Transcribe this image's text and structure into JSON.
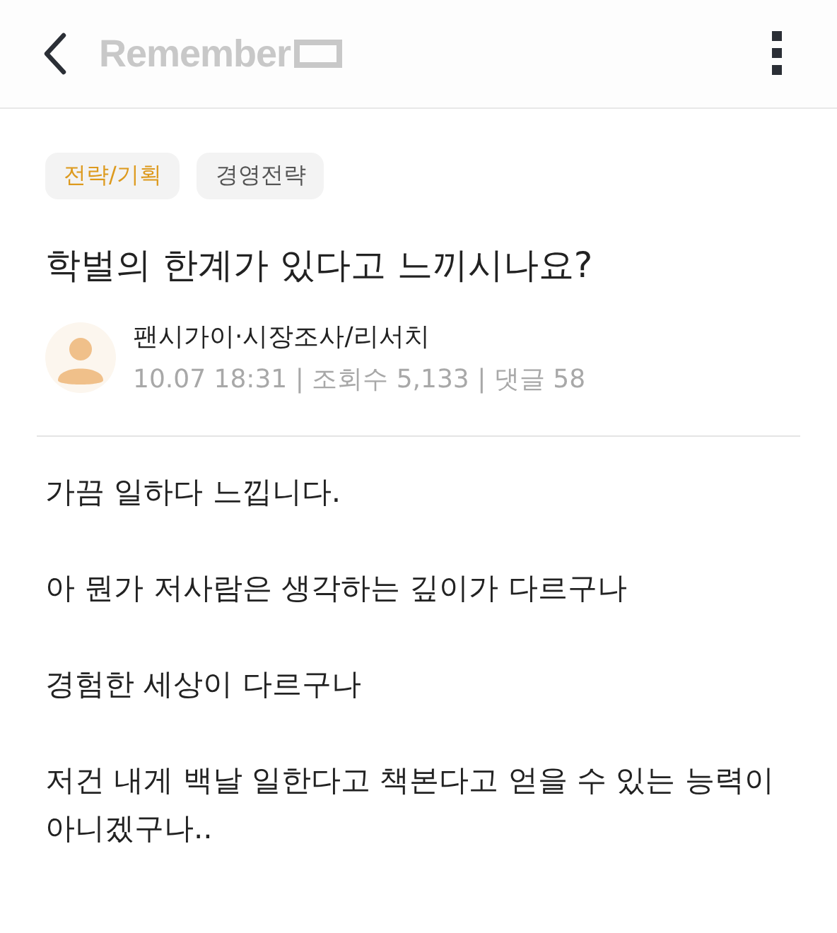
{
  "header": {
    "logo": "Remember"
  },
  "tags": [
    {
      "label": "전략/기획",
      "color": "#dd9a1e"
    },
    {
      "label": "경영전략",
      "color": "#555555"
    }
  ],
  "title": "학벌의 한계가 있다고 느끼시나요?",
  "author": {
    "name": "팬시가이·시장조사/리서치",
    "meta": "10.07 18:31 | 조회수 5,133 | 댓글 58"
  },
  "body": [
    "가끔 일하다 느낍니다.",
    "아 뭔가 저사람은 생각하는 깊이가 다르구나",
    "경험한 세상이 다르구나",
    "저건 내게 백날 일한다고 책본다고 얻을 수 있는 능력이 아니겠구나.."
  ]
}
